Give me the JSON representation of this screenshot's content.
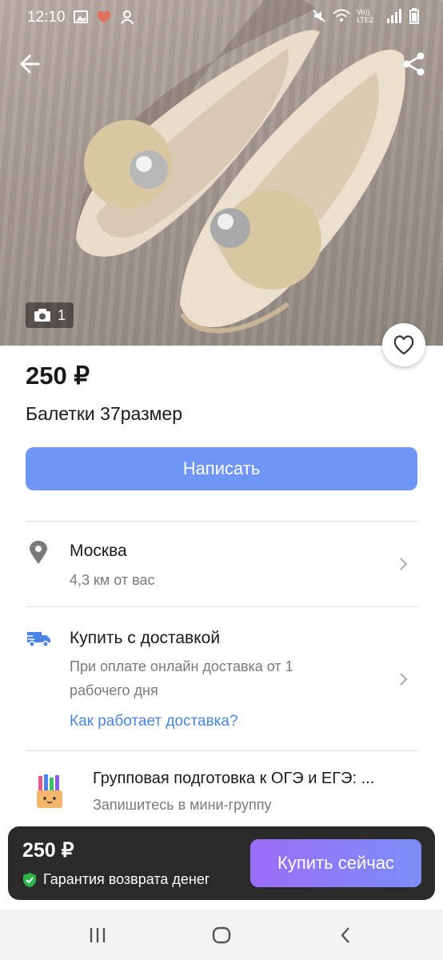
{
  "status_bar": {
    "time": "12:10",
    "network_label": "Vo)) LTE2"
  },
  "photo": {
    "count": "1"
  },
  "listing": {
    "price": "250 ₽",
    "title": "Балетки 37размер"
  },
  "actions": {
    "write_label": "Написать"
  },
  "location": {
    "city": "Москва",
    "distance": "4,3 км от вас"
  },
  "delivery": {
    "title": "Купить с доставкой",
    "description_line1": "При оплате онлайн доставка от 1",
    "description_line2": "рабочего дня",
    "link": "Как работает доставка?"
  },
  "promo": {
    "title": "Групповая подготовка к ОГЭ и ЕГЭ: ...",
    "subtitle": "Запишитесь в мини-группу"
  },
  "bottom_bar": {
    "price": "250 ₽",
    "guarantee": "Гарантия возврата денег",
    "buy_label": "Купить сейчас"
  },
  "colors": {
    "accent_blue": "#6f96f7",
    "link_blue": "#4a86e8",
    "buy_gradient_start": "#9b6df7",
    "buy_gradient_end": "#7c8df7",
    "guarantee_green": "#2bb34a"
  }
}
